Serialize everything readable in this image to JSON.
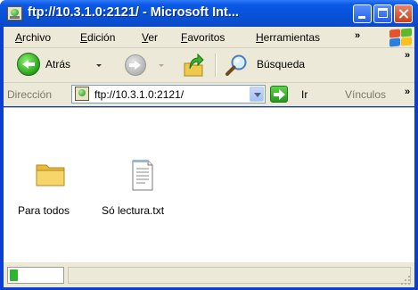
{
  "window": {
    "title": "ftp://10.3.1.0:2121/ - Microsoft Int...",
    "icon": "ie-globe-icon"
  },
  "menubar": {
    "items": [
      {
        "label": "Archivo",
        "accesskey": "A"
      },
      {
        "label": "Edición",
        "accesskey": "E"
      },
      {
        "label": "Ver",
        "accesskey": "V"
      },
      {
        "label": "Favoritos",
        "accesskey": "F"
      },
      {
        "label": "Herramientas",
        "accesskey": "H"
      }
    ],
    "overflow": "»"
  },
  "toolbar": {
    "back_label": "Atrás",
    "search_label": "Búsqueda",
    "overflow": "»"
  },
  "addressbar": {
    "label": "Dirección",
    "value": "ftp://10.3.1.0:2121/",
    "go_label": "Ir",
    "links_label": "Vínculos",
    "overflow": "»"
  },
  "content": {
    "items": [
      {
        "name": "Para todos",
        "type": "folder"
      },
      {
        "name": "Só lectura.txt",
        "type": "text-file"
      }
    ]
  },
  "statusbar": {
    "progress": 0.15
  },
  "colors": {
    "titlebar": "#0a58e6",
    "chrome": "#ece9d8",
    "accent_green": "#2db52d"
  }
}
